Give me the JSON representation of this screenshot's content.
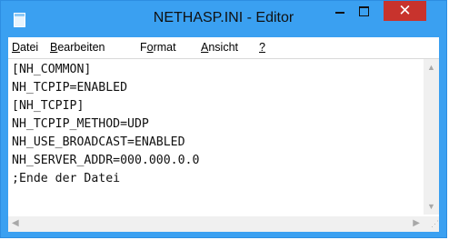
{
  "window": {
    "title": "NETHASP.INI - Editor"
  },
  "controls": {
    "minimize": "–",
    "maximize": "□",
    "close": "✕"
  },
  "menu": {
    "file": {
      "label": "Datei",
      "u": "D",
      "rest": "atei"
    },
    "edit": {
      "label": "Bearbeiten",
      "u": "B",
      "rest": "earbeiten"
    },
    "format": {
      "label": "Format",
      "pre": "F",
      "u": "o",
      "rest": "rmat"
    },
    "view": {
      "label": "Ansicht",
      "u": "A",
      "rest": "nsicht"
    },
    "help": {
      "label": "?",
      "u": "?"
    }
  },
  "document": {
    "lines": [
      "[NH_COMMON]",
      "NH_TCPIP=ENABLED",
      "[NH_TCPIP]",
      "NH_TCPIP_METHOD=UDP",
      "NH_USE_BROADCAST=ENABLED",
      "NH_SERVER_ADDR=000.000.0.0",
      ";Ende der Datei"
    ]
  },
  "icons": {
    "app": "notepad-icon",
    "scroll_up": "▲",
    "scroll_down": "▼",
    "scroll_left": "◀",
    "scroll_right": "▶"
  }
}
